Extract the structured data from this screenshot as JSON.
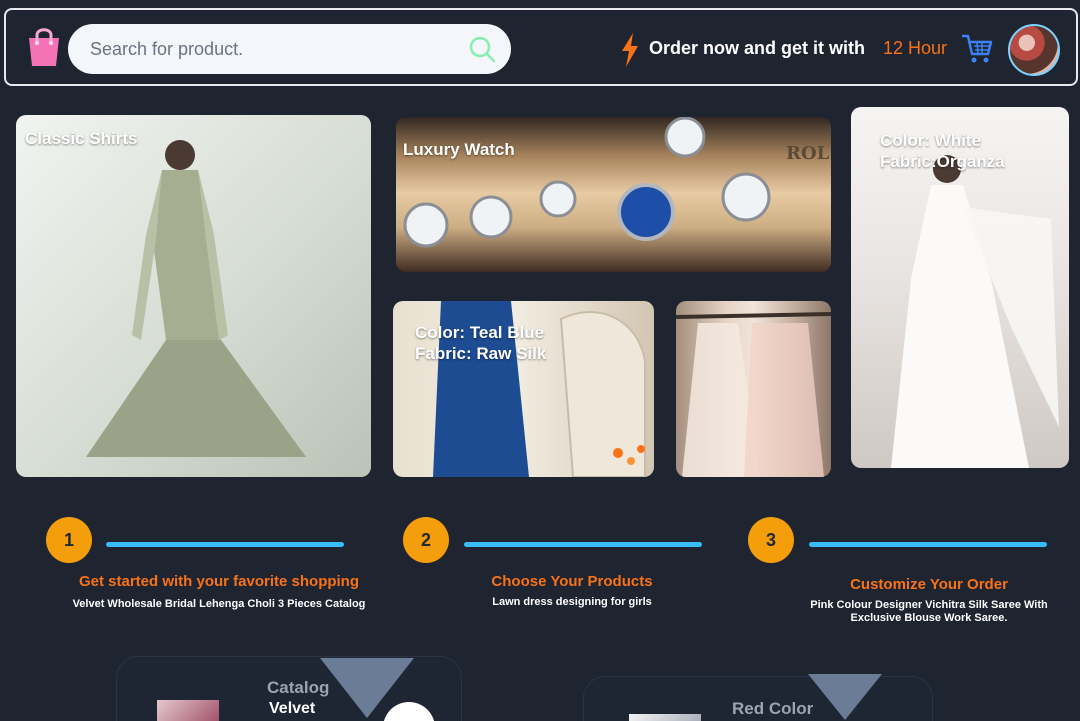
{
  "header": {
    "search_placeholder": "Search for product.",
    "promo_text": "Order now and get it with",
    "promo_time": "12 Hour",
    "icons": [
      "shopping-bag-icon",
      "search-icon",
      "lightning-bolt-icon",
      "shopping-cart-icon",
      "user-avatar"
    ]
  },
  "gallery": [
    {
      "label": "Classic Shirts"
    },
    {
      "label": "Luxury Watch"
    },
    {
      "label": "Color: Teal Blue\n Fabric: Raw Silk"
    },
    {
      "label": ""
    },
    {
      "label": "Color: White\nFabric:Organza"
    }
  ],
  "steps": [
    {
      "number": "1",
      "title": "Get started with your favorite shopping",
      "desc": "Velvet Wholesale Bridal Lehenga Choli 3 Pieces Catalog"
    },
    {
      "number": "2",
      "title": "Choose Your Products",
      "desc": "Lawn dress designing for girls"
    },
    {
      "number": "3",
      "title": "Customize Your Order",
      "desc": "Pink Colour Designer Vichitra Silk Saree With Exclusive Blouse  Work Saree."
    }
  ],
  "products": [
    {
      "category": "Catalog",
      "name": "Velvet"
    },
    {
      "category": "Red Color",
      "name": ""
    }
  ],
  "colors": {
    "background": "#1e2430",
    "accent_orange": "#f97316",
    "step_badge": "#f59e0b",
    "progress_line": "#38bdf8",
    "cart_blue": "#3b82f6",
    "bag_pink": "#f472b6"
  }
}
